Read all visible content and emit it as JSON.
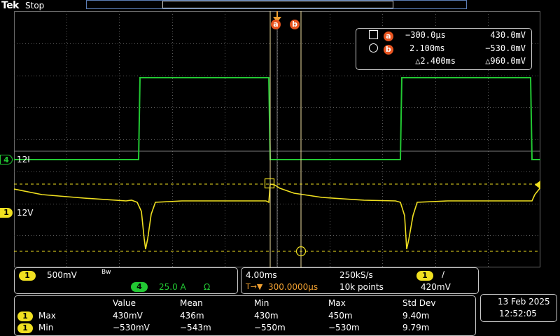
{
  "brand": "Tek",
  "acq_state": "Stop",
  "cursor_labels": {
    "a": "a",
    "b": "b"
  },
  "cursor_readout": {
    "a_time": "−300.0µs",
    "a_value": "430.0mV",
    "b_time": "2.100ms",
    "b_value": "−530.0mV",
    "delta_time": "△2.400ms",
    "delta_value": "△960.0mV"
  },
  "channels": {
    "ch4": {
      "number": "4",
      "label": "12I",
      "color": "#22c833"
    },
    "ch1": {
      "number": "1",
      "label": "12V",
      "color": "#f0e020"
    }
  },
  "vertical": {
    "ch1_scale": "500mV",
    "ch1_bw": "Bᴡ",
    "ch4_scale": "25.0 A",
    "ch4_unit": "Ω"
  },
  "horizontal": {
    "timebase": "4.00ms",
    "sample_rate": "250kS/s",
    "trigger_channel": "1",
    "trigger_slope": "∕",
    "trigger_delay_icon": "T→▼",
    "trigger_delay": "300.0000µs",
    "record_length": "10k points",
    "trigger_level": "420mV"
  },
  "measurements": {
    "headers": [
      "Value",
      "Mean",
      "Min",
      "Max",
      "Std Dev"
    ],
    "rows": [
      {
        "channel": "1",
        "name": "Max",
        "values": [
          "430mV",
          "436m",
          "430m",
          "450m",
          "9.40m"
        ]
      },
      {
        "channel": "1",
        "name": "Min",
        "values": [
          "−530mV",
          "−543m",
          "−550m",
          "−530m",
          "9.79m"
        ]
      }
    ]
  },
  "datetime": {
    "date": "13 Feb  2025",
    "time": "12:52:05"
  },
  "colors": {
    "ch1": "#f0e020",
    "ch4": "#22c833",
    "cursor_badge": "#e8541f",
    "record_bar": "#5b7db5"
  }
}
